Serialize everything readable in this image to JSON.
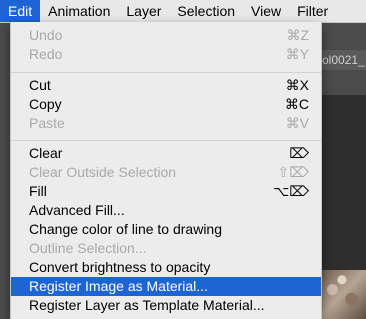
{
  "menubar": {
    "items": [
      "Edit",
      "Animation",
      "Layer",
      "Selection",
      "View",
      "Filter"
    ]
  },
  "background": {
    "tab_label": "ol0021_"
  },
  "menu": {
    "items": [
      {
        "label": "Undo",
        "shortcut": "⌘Z",
        "enabled": false
      },
      {
        "label": "Redo",
        "shortcut": "⌘Y",
        "enabled": false
      },
      {
        "label": "Cut",
        "shortcut": "⌘X",
        "enabled": true
      },
      {
        "label": "Copy",
        "shortcut": "⌘C",
        "enabled": true
      },
      {
        "label": "Paste",
        "shortcut": "⌘V",
        "enabled": false
      },
      {
        "label": "Clear",
        "shortcut": "⌦",
        "enabled": true
      },
      {
        "label": "Clear Outside Selection",
        "shortcut": "⇧⌦",
        "enabled": false
      },
      {
        "label": "Fill",
        "shortcut": "⌥⌦",
        "enabled": true
      },
      {
        "label": "Advanced Fill...",
        "shortcut": "",
        "enabled": true
      },
      {
        "label": "Change color of line to drawing",
        "shortcut": "",
        "enabled": true
      },
      {
        "label": "Outline Selection...",
        "shortcut": "",
        "enabled": false
      },
      {
        "label": "Convert brightness to opacity",
        "shortcut": "",
        "enabled": true
      },
      {
        "label": "Register Image as Material...",
        "shortcut": "",
        "enabled": true,
        "selected": true
      },
      {
        "label": "Register Layer as Template Material...",
        "shortcut": "",
        "enabled": true
      }
    ]
  },
  "colors": {
    "accent": "#1f64d4",
    "menu_bg": "#ececec",
    "disabled_text": "#a9a9a9"
  }
}
